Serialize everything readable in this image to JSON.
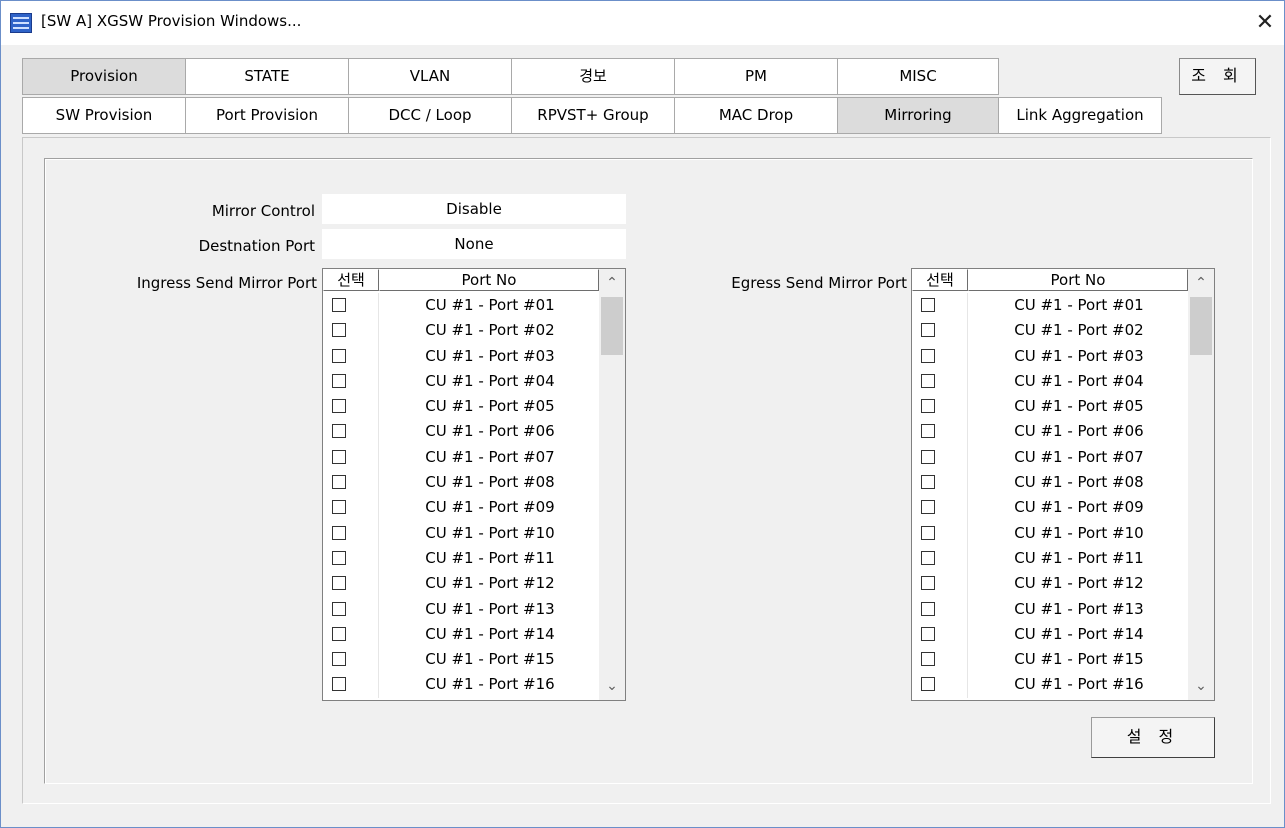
{
  "window": {
    "title": "[SW A] XGSW Provision Windows...",
    "close_label": "✕"
  },
  "tabs_top": [
    {
      "label": "Provision",
      "active": true
    },
    {
      "label": "STATE",
      "active": false
    },
    {
      "label": "VLAN",
      "active": false
    },
    {
      "label": "경보",
      "active": false
    },
    {
      "label": "PM",
      "active": false
    },
    {
      "label": "MISC",
      "active": false
    }
  ],
  "tabs_sub": [
    {
      "label": "SW Provision",
      "active": false
    },
    {
      "label": "Port Provision",
      "active": false
    },
    {
      "label": "DCC / Loop",
      "active": false
    },
    {
      "label": "RPVST+ Group",
      "active": false
    },
    {
      "label": "MAC Drop",
      "active": false
    },
    {
      "label": "Mirroring",
      "active": true
    },
    {
      "label": "Link Aggregation",
      "active": false
    }
  ],
  "query_button": "조 회",
  "mirror": {
    "control_label": "Mirror Control",
    "control_value": "Disable",
    "dest_label": "Destnation Port",
    "dest_value": "None",
    "ingress_label": "Ingress Send Mirror Port",
    "egress_label": "Egress Send Mirror Port",
    "col_select": "선택",
    "col_port": "Port No"
  },
  "ports": [
    "CU #1 - Port #01",
    "CU #1 - Port #02",
    "CU #1 - Port #03",
    "CU #1 - Port #04",
    "CU #1 - Port #05",
    "CU #1 - Port #06",
    "CU #1 - Port #07",
    "CU #1 - Port #08",
    "CU #1 - Port #09",
    "CU #1 - Port #10",
    "CU #1 - Port #11",
    "CU #1 - Port #12",
    "CU #1 - Port #13",
    "CU #1 - Port #14",
    "CU #1 - Port #15",
    "CU #1 - Port #16"
  ],
  "set_button": "설 정",
  "icons": {
    "app": "app-icon",
    "close": "close-icon",
    "scroll_up": "chevron-up-icon",
    "scroll_down": "chevron-down-icon"
  }
}
